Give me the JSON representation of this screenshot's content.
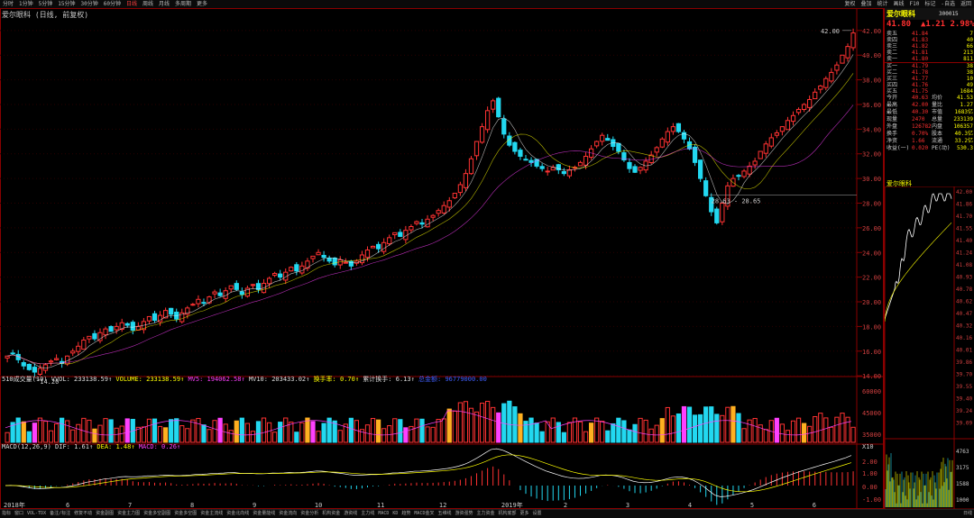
{
  "toolbar": {
    "items": [
      "分时",
      "1分钟",
      "5分钟",
      "15分钟",
      "30分钟",
      "60分钟",
      "日线",
      "周线",
      "月线",
      "多周期",
      "更多"
    ],
    "active_index": 6,
    "right_items": [
      "复权",
      "叠加",
      "统计",
      "画线",
      "F10",
      "标记",
      "-自选",
      "返回"
    ]
  },
  "chart_title": "爱尔眼科 (日线, 前复权)",
  "quote": {
    "name": "爱尔眼科",
    "code": "300015",
    "price": "41.80",
    "change": "▲1.21",
    "change_pct": "2.98%",
    "asks": [
      {
        "label": "卖五",
        "price": "41.84",
        "vol": "7"
      },
      {
        "label": "卖四",
        "price": "41.83",
        "vol": "40"
      },
      {
        "label": "卖三",
        "price": "41.82",
        "vol": "66"
      },
      {
        "label": "卖二",
        "price": "41.81",
        "vol": "213"
      },
      {
        "label": "卖一",
        "price": "41.80",
        "vol": "811"
      }
    ],
    "bids": [
      {
        "label": "买一",
        "price": "41.79",
        "vol": "38"
      },
      {
        "label": "买二",
        "price": "41.78",
        "vol": "38"
      },
      {
        "label": "买三",
        "price": "41.77",
        "vol": "10"
      },
      {
        "label": "买四",
        "price": "41.76",
        "vol": "49"
      },
      {
        "label": "买五",
        "price": "41.75",
        "vol": "1684"
      }
    ],
    "stats": [
      {
        "l": "今开",
        "v": "40.63",
        "l2": "均价",
        "v2": "41.53"
      },
      {
        "l": "最高",
        "v": "42.00",
        "l2": "量比",
        "v2": "1.27"
      },
      {
        "l": "最低",
        "v": "40.30",
        "l2": "市值",
        "v2": "1683亿"
      },
      {
        "l": "现量",
        "v": "2470",
        "l2": "总量",
        "v2": "233139"
      },
      {
        "l": "外盘",
        "v": "126782",
        "l2": "内盘",
        "v2": "106357"
      },
      {
        "l": "换手",
        "v": "0.70%",
        "l2": "股本",
        "v2": "40.3亿"
      },
      {
        "l": "净资",
        "v": "1.66",
        "l2": "流通",
        "v2": "33.2亿"
      },
      {
        "l": "收益(一)",
        "v": "0.020",
        "l2": "PE(动)",
        "v2": "530.3"
      }
    ],
    "mini_title": "爱尔眼科",
    "mini_right_labels": [
      "42.00",
      "41.86",
      "41.70",
      "41.55",
      "41.40",
      "41.24",
      "41.08",
      "40.93",
      "40.78",
      "40.62",
      "40.47",
      "40.32",
      "40.16",
      "40.01",
      "39.86",
      "39.70",
      "39.55",
      "39.40",
      "39.24",
      "39.09"
    ],
    "mini_vol_labels": [
      "4763",
      "3175",
      "1588",
      "1000"
    ]
  },
  "price_axis": [
    "42.00",
    "40.00",
    "38.00",
    "36.00",
    "34.00",
    "32.00",
    "30.00",
    "28.00",
    "26.00",
    "24.00",
    "22.00",
    "20.00",
    "18.00",
    "16.00",
    "14.00"
  ],
  "annotations": {
    "high_label": "42.00",
    "low_label": "14.20",
    "range_label": "28.63 - 28.65"
  },
  "volume_indicator": {
    "name": "510成交量(10)",
    "vvol": "VVOL: 233138.59↑",
    "volume": "VOLUME: 233138.59↑",
    "mv5": "MV5: 194062.58↑",
    "mv10": "MV10: 203433.02↑",
    "turnover": "换手率: 0.70↑",
    "cum_turnover": "累计换手: 6.13↑",
    "total": "总金额: 96779000.00"
  },
  "volume_axis": [
    "60000",
    "45000",
    "35000"
  ],
  "volume_unit": "X10",
  "macd_indicator": {
    "name": "MACD(12,26,9)",
    "dif": "DIF: 1.61↑",
    "dea": "DEA: 1.48↑",
    "macd": "MACD: 0.26↑"
  },
  "macd_axis": [
    "2.00",
    "1.00",
    "0.00",
    "-1.00"
  ],
  "date_axis": [
    "2018年",
    "6",
    "7",
    "8",
    "9",
    "10",
    "11",
    "12",
    "2019年",
    "2",
    "3",
    "4",
    "5",
    "6"
  ],
  "bottombar": [
    "指标",
    "窗口",
    "VOL-TDX",
    "备注/标注",
    "修复不动",
    "资金副图",
    "资金主力图",
    "资金多空副图",
    "资金多空图",
    "资金主流线",
    "资金北向线",
    "资金量能线",
    "资金流向",
    "资金分析",
    "机构资金",
    "游资线",
    "主力线",
    "MACD",
    "KD",
    "趋势",
    "MACD金叉",
    "五维线",
    "游资强势",
    "主力资金",
    "机构底部",
    "更多",
    "设置"
  ],
  "bottom_right": "日线",
  "colors": {
    "up": "#ff3232",
    "down": "#22d8f0",
    "ma5": "#ffffff",
    "ma10": "#ffff00",
    "ma20": "#ff40ff",
    "border": "#8a0000"
  },
  "chart_data": {
    "type": "candlestick",
    "x_range": [
      "2018-05",
      "2019-06"
    ],
    "ylim": [
      13.5,
      42.5
    ],
    "high": 42.0,
    "low": 14.2,
    "closes": [
      15.6,
      15.8,
      15.3,
      14.8,
      14.5,
      14.3,
      14.6,
      14.9,
      15.2,
      15.4,
      15.0,
      15.6,
      16.0,
      16.4,
      16.9,
      17.2,
      17.0,
      17.5,
      17.8,
      17.6,
      18.0,
      18.3,
      18.1,
      17.7,
      18.0,
      18.4,
      18.8,
      18.5,
      18.9,
      19.3,
      19.0,
      18.6,
      19.1,
      19.5,
      19.8,
      20.2,
      19.9,
      20.4,
      20.8,
      20.5,
      20.9,
      21.3,
      21.0,
      20.6,
      21.1,
      21.4,
      21.0,
      21.5,
      21.9,
      22.3,
      22.0,
      22.4,
      22.8,
      22.5,
      22.9,
      23.3,
      23.7,
      24.0,
      23.6,
      23.3,
      23.0,
      23.4,
      23.2,
      22.9,
      23.3,
      23.8,
      24.2,
      24.5,
      24.3,
      24.8,
      25.2,
      25.6,
      25.3,
      25.8,
      26.1,
      26.5,
      26.3,
      26.7,
      27.0,
      27.4,
      27.8,
      28.2,
      28.8,
      29.5,
      30.4,
      31.6,
      33.0,
      34.2,
      35.5,
      36.3,
      35.0,
      33.6,
      32.7,
      32.2,
      31.8,
      31.5,
      31.3,
      31.0,
      30.8,
      30.6,
      30.9,
      30.7,
      30.4,
      30.7,
      30.9,
      31.3,
      31.8,
      32.4,
      33.0,
      33.5,
      33.1,
      32.6,
      32.2,
      31.5,
      30.8,
      30.5,
      30.9,
      31.4,
      31.9,
      32.5,
      33.2,
      33.8,
      34.2,
      33.8,
      33.2,
      32.4,
      31.3,
      30.0,
      28.6,
      27.3,
      26.4,
      28.0,
      29.4,
      30.0,
      30.2,
      30.6,
      31.0,
      31.4,
      32.2,
      32.8,
      33.3,
      33.7,
      34.2,
      34.7,
      35.1,
      35.6,
      36.0,
      36.4,
      37.0,
      37.5,
      38.1,
      38.6,
      39.2,
      40.0,
      40.7,
      41.8
    ]
  }
}
